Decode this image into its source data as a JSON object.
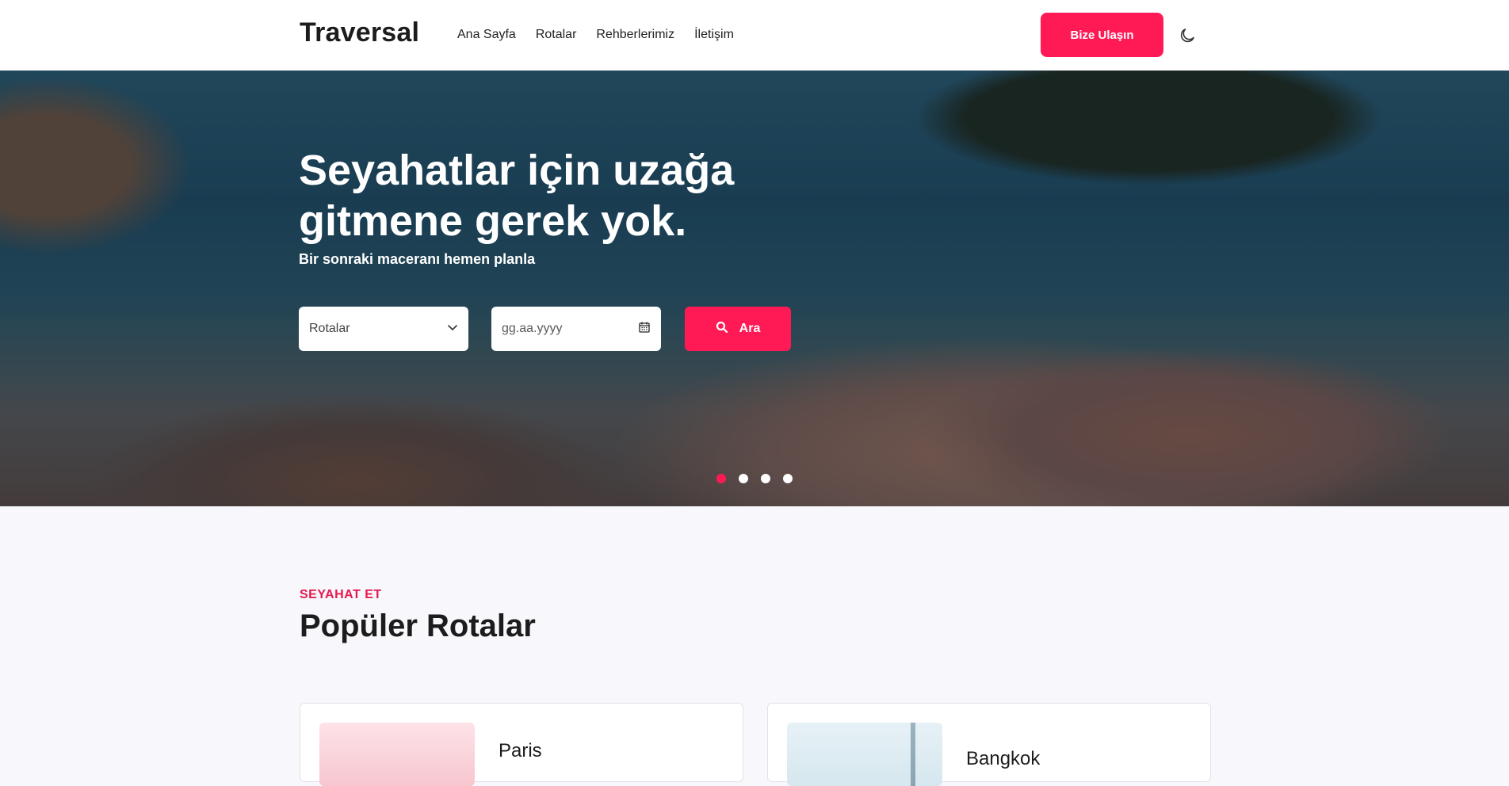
{
  "header": {
    "logo": "Traversal",
    "nav": [
      "Ana Sayfa",
      "Rotalar",
      "Rehberlerimiz",
      "İletişim"
    ],
    "cta": "Bize Ulaşın",
    "theme_toggle_icon": "moon-icon"
  },
  "hero": {
    "title_line1": "Seyahatlar için uzağa",
    "title_line2": "gitmene gerek yok.",
    "subtitle": "Bir sonraki maceranı hemen planla",
    "route_select": {
      "selected": "Rotalar",
      "icon": "chevron-down-icon"
    },
    "date_input": {
      "placeholder": "gg.aa.yyyy",
      "icon": "calendar-icon"
    },
    "search_button": {
      "label": "Ara",
      "icon": "search-icon"
    },
    "carousel": {
      "total": 4,
      "active": 1
    }
  },
  "section": {
    "eyebrow": "SEYAHAT ET",
    "title": "Popüler Rotalar"
  },
  "cards": [
    {
      "title": "Paris"
    },
    {
      "title": "Bangkok"
    }
  ],
  "colors": {
    "accent": "#ff1a55",
    "background": "#f7f7fc"
  }
}
